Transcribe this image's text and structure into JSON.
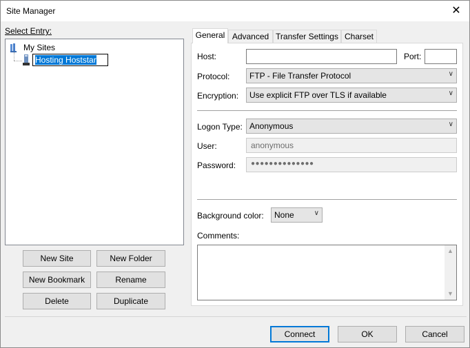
{
  "window": {
    "title": "Site Manager",
    "close_glyph": "✕"
  },
  "left": {
    "select_entry_label": "Select Entry:",
    "tree": {
      "root_label": "My Sites",
      "child_label": "Hosting Hoststar"
    }
  },
  "left_buttons": {
    "new_site": "New Site",
    "new_folder": "New Folder",
    "new_bookmark": "New Bookmark",
    "rename": "Rename",
    "delete": "Delete",
    "duplicate": "Duplicate"
  },
  "tabs": [
    "General",
    "Advanced",
    "Transfer Settings",
    "Charset"
  ],
  "general": {
    "host_label": "Host:",
    "host_value": "",
    "port_label": "Port:",
    "port_value": "",
    "protocol_label": "Protocol:",
    "protocol_value": "FTP - File Transfer Protocol",
    "encryption_label": "Encryption:",
    "encryption_value": "Use explicit FTP over TLS if available",
    "logon_type_label": "Logon Type:",
    "logon_type_value": "Anonymous",
    "user_label": "User:",
    "user_value": "anonymous",
    "password_label": "Password:",
    "password_value": "●●●●●●●●●●●●●●",
    "bg_color_label": "Background color:",
    "bg_color_value": "None",
    "comments_label": "Comments:"
  },
  "footer": {
    "connect": "Connect",
    "ok": "OK",
    "cancel": "Cancel"
  },
  "icons": {
    "chevron": "chevron-down-icon",
    "server": "server-icon",
    "folder": "folder-icon"
  },
  "colors": {
    "accent": "#0078d7",
    "button_face": "#e1e1e1"
  }
}
